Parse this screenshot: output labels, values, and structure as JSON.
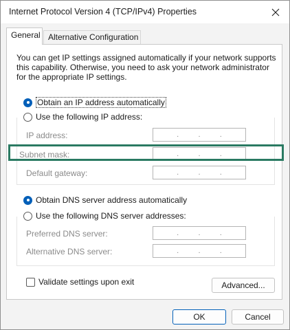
{
  "window": {
    "title": "Internet Protocol Version 4 (TCP/IPv4) Properties",
    "close_icon": "close-icon"
  },
  "tabs": [
    {
      "label": "General",
      "active": true
    },
    {
      "label": "Alternative Configuration",
      "active": false
    }
  ],
  "general": {
    "description": "You can get IP settings assigned automatically if your network supports this capability. Otherwise, you need to ask your network administrator for the appropriate IP settings.",
    "ip_auto_label": "Obtain an IP address automatically",
    "ip_manual_label": "Use the following IP address:",
    "ip_mode": "auto",
    "fields": {
      "ip_address": {
        "label": "IP address:",
        "value": ". . ."
      },
      "subnet_mask": {
        "label": "Subnet mask:",
        "value": ". . ."
      },
      "default_gateway": {
        "label": "Default gateway:",
        "value": ". . ."
      }
    },
    "dns_auto_label": "Obtain DNS server address automatically",
    "dns_manual_label": "Use the following DNS server addresses:",
    "dns_mode": "auto",
    "dns_fields": {
      "preferred": {
        "label": "Preferred DNS server:",
        "value": ". . ."
      },
      "alternative": {
        "label": "Alternative DNS server:",
        "value": ". . ."
      }
    },
    "validate_label": "Validate settings upon exit",
    "validate_checked": false,
    "advanced_label": "Advanced..."
  },
  "footer": {
    "ok_label": "OK",
    "cancel_label": "Cancel"
  },
  "colors": {
    "accent": "#005fb8",
    "highlight": "#2a7a62"
  }
}
